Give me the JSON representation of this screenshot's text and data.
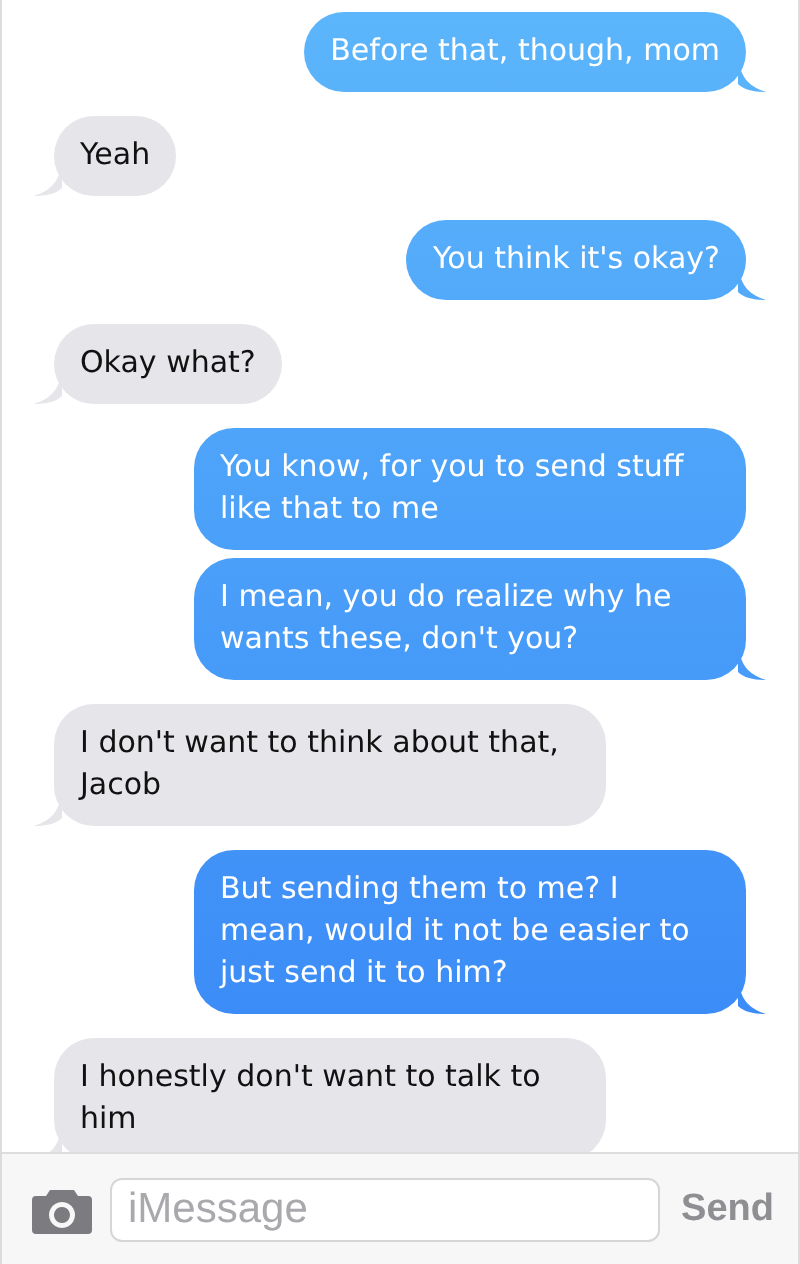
{
  "messages": [
    {
      "kind": "sent",
      "text": "Before that, though, mom",
      "tail": true
    },
    {
      "kind": "received",
      "text": "Yeah",
      "tail": true
    },
    {
      "kind": "sent",
      "text": "You think it's okay?",
      "tail": true
    },
    {
      "kind": "received",
      "text": "Okay what?",
      "tail": true
    },
    {
      "kind": "sent",
      "text": "You know, for you to send stuff like that to me",
      "tail": false
    },
    {
      "kind": "sent",
      "text": "I mean, you do realize why he wants these, don't you?",
      "tail": true
    },
    {
      "kind": "received",
      "text": "I don't want to think about that, Jacob",
      "tail": true
    },
    {
      "kind": "sent",
      "text": "But sending them to me? I mean, would it not be easier to just send it to him?",
      "tail": true
    },
    {
      "kind": "received",
      "text": "I honestly don't want to talk to him",
      "tail": true
    }
  ],
  "compose": {
    "placeholder": "iMessage",
    "send_label": "Send"
  }
}
